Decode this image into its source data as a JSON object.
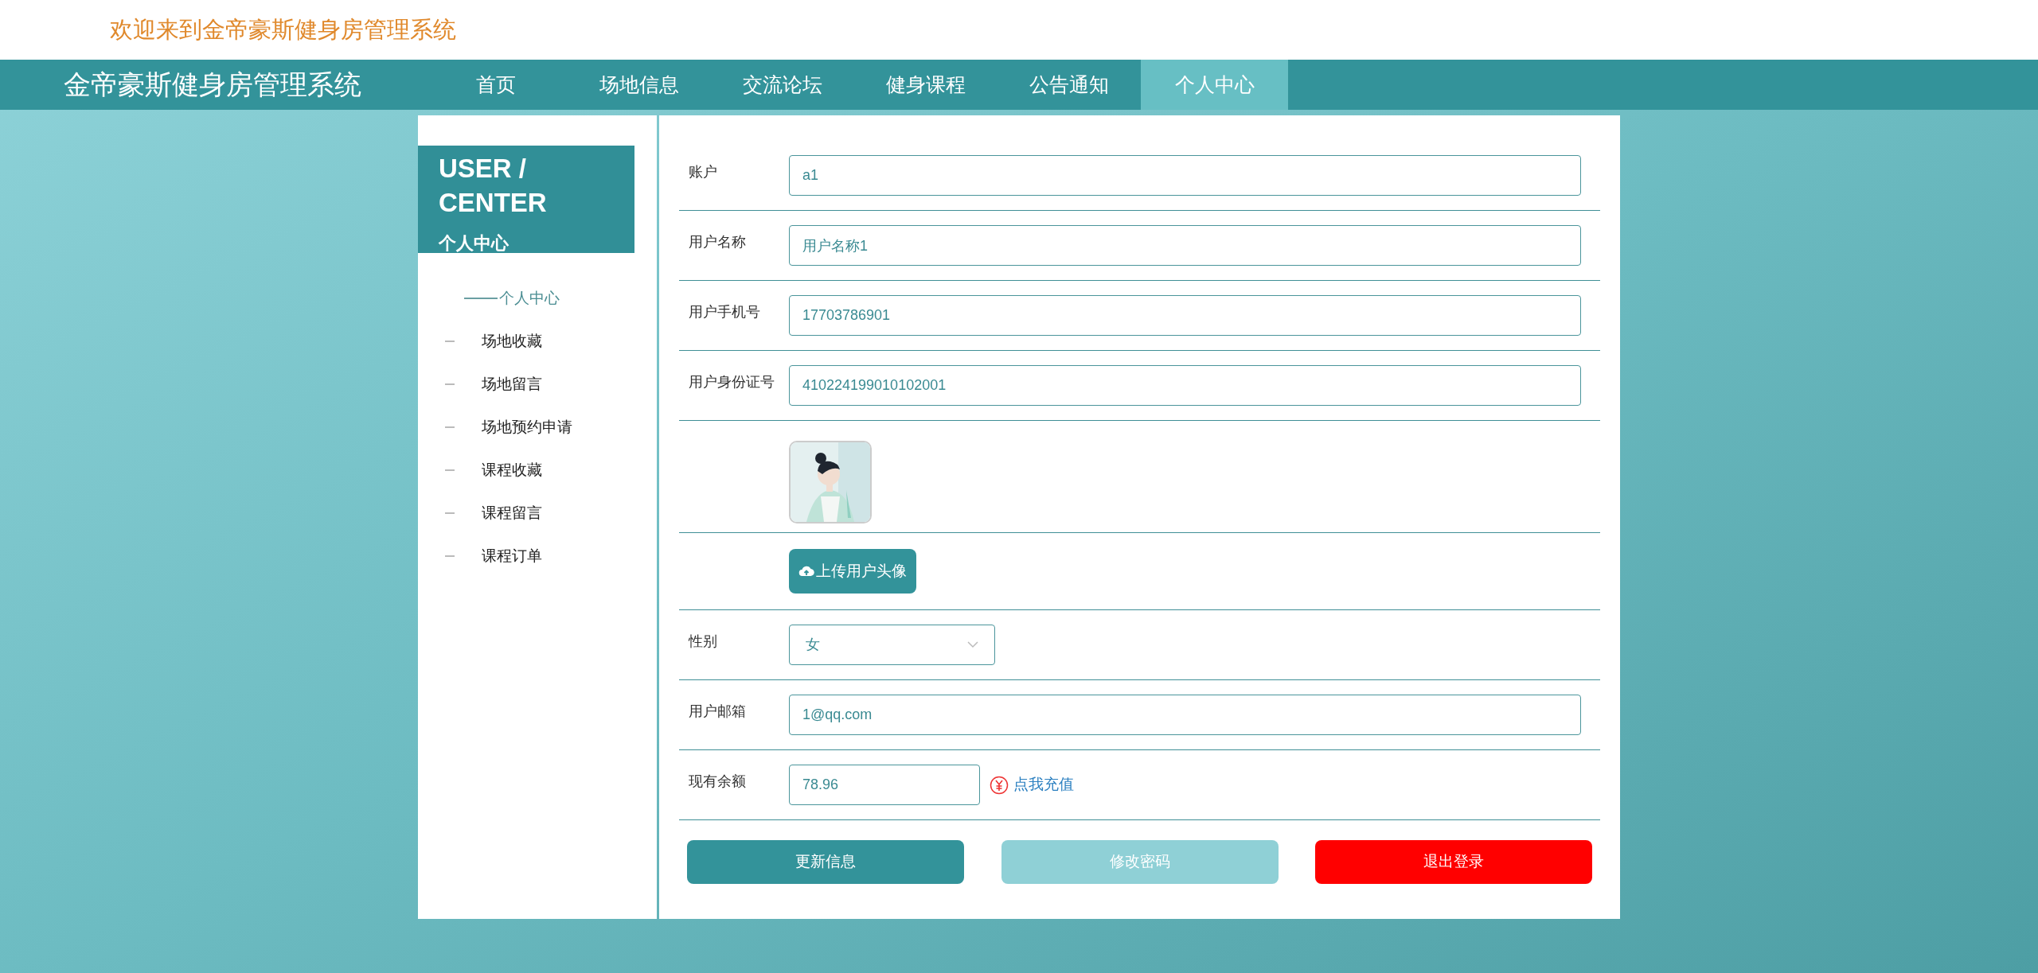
{
  "header": {
    "welcome": "欢迎来到金帝豪斯健身房管理系统"
  },
  "nav": {
    "brand": "金帝豪斯健身房管理系统",
    "items": [
      {
        "label": "首页",
        "selected": false
      },
      {
        "label": "场地信息",
        "selected": false
      },
      {
        "label": "交流论坛",
        "selected": false
      },
      {
        "label": "健身课程",
        "selected": false
      },
      {
        "label": "公告通知",
        "selected": false
      },
      {
        "label": "个人中心",
        "selected": true
      }
    ]
  },
  "sidebar": {
    "title": "USER / CENTER",
    "subtitle": "个人中心",
    "items": [
      {
        "label": "个人中心",
        "selected": true
      },
      {
        "label": "场地收藏",
        "selected": false
      },
      {
        "label": "场地留言",
        "selected": false
      },
      {
        "label": "场地预约申请",
        "selected": false
      },
      {
        "label": "课程收藏",
        "selected": false
      },
      {
        "label": "课程留言",
        "selected": false
      },
      {
        "label": "课程订单",
        "selected": false
      }
    ]
  },
  "form": {
    "fields": [
      {
        "kind": "text",
        "label": "账户",
        "value": "a1"
      },
      {
        "kind": "text",
        "label": "用户名称",
        "value": "用户名称1"
      },
      {
        "kind": "text",
        "label": "用户手机号",
        "value": "17703786901"
      },
      {
        "kind": "text",
        "label": "用户身份证号",
        "value": "410224199010102001"
      },
      {
        "kind": "picture"
      },
      {
        "kind": "upload",
        "button": "上传用户头像"
      },
      {
        "kind": "select",
        "label": "性别",
        "value": "女"
      },
      {
        "kind": "text",
        "label": "用户邮箱",
        "value": "1@qq.com"
      },
      {
        "kind": "balance",
        "label": "现有余额",
        "value": "78.96",
        "link": "点我充值"
      }
    ]
  },
  "buttons": [
    {
      "label": "更新信息",
      "kind": "primary"
    },
    {
      "label": "修改密码",
      "kind": "secondary"
    },
    {
      "label": "退出登录",
      "kind": "danger"
    }
  ]
}
